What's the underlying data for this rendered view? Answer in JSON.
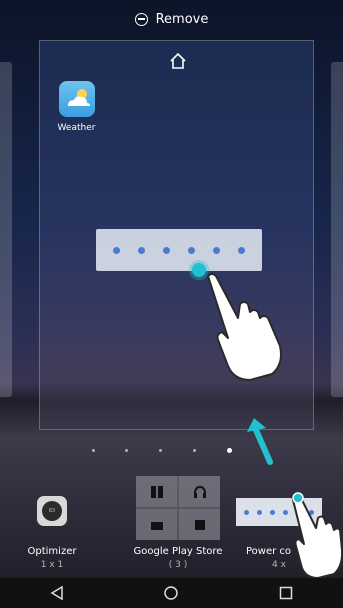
{
  "top_bar": {
    "remove_label": "Remove"
  },
  "preview": {
    "app": {
      "label": "Weather",
      "icon": "weather-icon"
    }
  },
  "pages": {
    "count": 5,
    "active_index": 4
  },
  "tray": {
    "items": [
      {
        "label": "Optimizer",
        "size": "1 x 1",
        "icon": "optimizer-icon"
      },
      {
        "label": "Google Play Store",
        "size": "( 3 )",
        "icon": "folder-icon"
      },
      {
        "label": "Power co",
        "size": "4 x",
        "icon": "power-control-widget"
      }
    ]
  },
  "nav": {
    "buttons": [
      "back-icon",
      "home-circle-icon",
      "recents-icon"
    ]
  },
  "colors": {
    "accent": "#22c0d0",
    "widget_accent": "#4b7ccf"
  }
}
